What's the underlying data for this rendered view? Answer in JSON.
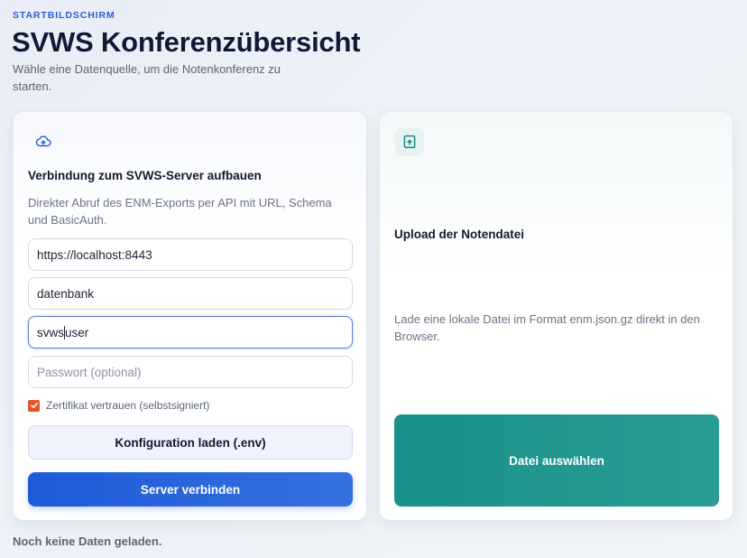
{
  "header": {
    "eyebrow": "STARTBILDSCHIRM",
    "title": "SVWS Konferenzübersicht",
    "subtitle": "Wähle eine Datenquelle, um die Notenkonferenz zu starten."
  },
  "server_card": {
    "icon": "cloud-upload-icon",
    "title": "Verbindung zum SVWS-Server aufbauen",
    "description": "Direkter Abruf des ENM-Exports per API mit URL, Schema und BasicAuth.",
    "url_value": "https://localhost:8443",
    "schema_value": "datenbank",
    "user_value_before_caret": "svws",
    "user_value_after_caret": "user",
    "password_placeholder": "Passwort (optional)",
    "checkbox_label": "Zertifikat vertrauen (selbstsigniert)",
    "checkbox_checked": true,
    "load_config_label": "Konfiguration laden (.env)",
    "connect_label": "Server verbinden"
  },
  "upload_card": {
    "icon": "file-upload-icon",
    "title": "Upload der Notendatei",
    "description": "Lade eine lokale Datei im Format enm.json.gz direkt in den Browser.",
    "choose_file_label": "Datei auswählen"
  },
  "status_text": "Noch keine Daten geladen.",
  "colors": {
    "accent_blue": "#1f5ad8",
    "teal": "#17918a",
    "checkbox_orange": "#e5542a"
  }
}
